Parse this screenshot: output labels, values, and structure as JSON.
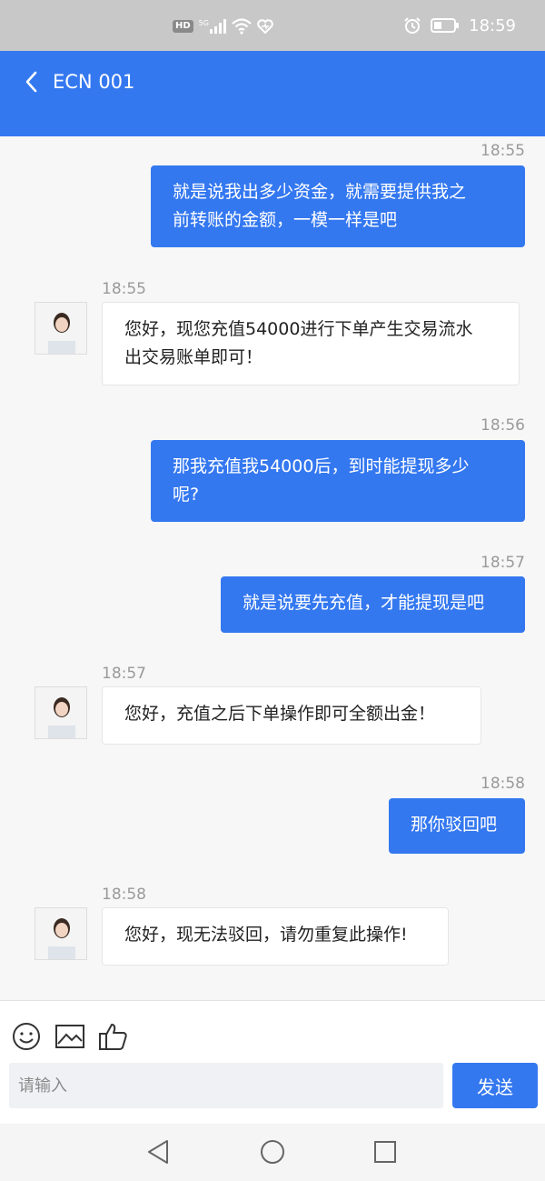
{
  "status_bar": {
    "hd": "HD",
    "net": "5G",
    "time": "18:59"
  },
  "header": {
    "title": "ECN 001",
    "back_icon": "chevron-left-icon"
  },
  "messages": [
    {
      "time": "18:55",
      "side": "out",
      "line1": "就是说我出多少资金，就需要提供我之",
      "line2": "前转账的金额，一模一样是吧"
    },
    {
      "time": "18:55",
      "side": "in",
      "line1": "您好，现您充值54000进行下单产生交易流水",
      "line2": "出交易账单即可！"
    },
    {
      "time": "18:56",
      "side": "out",
      "line1": "那我充值我54000后，到时能提现多少",
      "line2": "呢?"
    },
    {
      "time": "18:57",
      "side": "out",
      "line1": "就是说要先充值，才能提现是吧"
    },
    {
      "time": "18:57",
      "side": "in",
      "line1": "您好，充值之后下单操作即可全额出金！"
    },
    {
      "time": "18:58",
      "side": "out",
      "line1": "那你驳回吧"
    },
    {
      "time": "18:58",
      "side": "in",
      "line1": "您好，现无法驳回，请勿重复此操作!"
    }
  ],
  "input_bar": {
    "placeholder": "请输入",
    "send_label": "发送",
    "icons": [
      "emoji-icon",
      "image-icon",
      "thumbs-up-icon"
    ]
  },
  "colors": {
    "accent": "#3478f0",
    "status_bar": "#c8c8c8",
    "background": "#f7f7f7"
  }
}
